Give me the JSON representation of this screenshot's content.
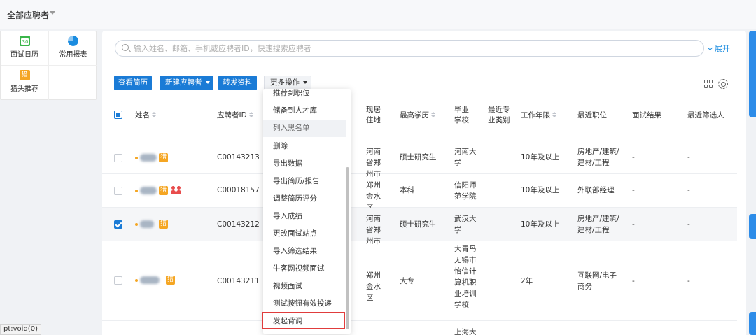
{
  "topbar": {
    "scope_label": "全部应聘者"
  },
  "quick_links": [
    {
      "label": "面试日历",
      "icon": "calendar-icon",
      "color": "#3ab54a"
    },
    {
      "label": "常用报表",
      "icon": "pie-chart-icon",
      "color": "#1a8ce0"
    },
    {
      "label": "猎头推荐",
      "icon": "headhunter-icon",
      "color": "#f5a623"
    }
  ],
  "search": {
    "placeholder": "输入姓名、邮箱、手机或应聘者ID，快速搜索应聘者",
    "value": "",
    "expand_label": "展开"
  },
  "toolbar": {
    "view_resume": "查看简历",
    "new_candidate": "新建应聘者",
    "forward": "转发资料",
    "more_actions": "更多操作"
  },
  "table": {
    "headers": {
      "name": "姓名",
      "id": "应聘者ID",
      "residence": "现居住地",
      "education": "最高学历",
      "school": "毕业学校",
      "major": "最近专业类别",
      "years": "工作年限",
      "position": "最近职位",
      "interview": "面试结果",
      "screener": "最近筛选人"
    },
    "rows": [
      {
        "checked": false,
        "id": "C00143213",
        "residence": "河南省郑州市",
        "education": "硕士研究生",
        "school": "河南大学",
        "major": "",
        "years": "10年及以上",
        "position": "房地产/建筑/建材/工程",
        "interview": "-",
        "screener": "-",
        "tag": "猎",
        "people": false
      },
      {
        "checked": false,
        "id": "C00018157",
        "residence": "郑州金水区",
        "education": "本科",
        "school": "信阳师范学院",
        "major": "",
        "years": "10年及以上",
        "position": "外联部经理",
        "interview": "-",
        "screener": "-",
        "tag": "猎",
        "people": true
      },
      {
        "checked": true,
        "id": "C00143212",
        "residence": "河南省郑州市",
        "education": "硕士研究生",
        "school": "武汉大学",
        "major": "",
        "years": "10年及以上",
        "position": "房地产/建筑/建材/工程",
        "interview": "-",
        "screener": "-",
        "tag": "猎",
        "people": false
      },
      {
        "checked": false,
        "id": "C00143211",
        "residence": "郑州金水区",
        "education": "大专",
        "school": "大青鸟无锡市怡信计算机职业培训学校",
        "major": "",
        "years": "2年",
        "position": "互联网/电子商务",
        "interview": "-",
        "screener": "-",
        "tag": "猎",
        "people": false
      }
    ],
    "partial_row": {
      "school": "上海大"
    }
  },
  "more_menu": {
    "items": [
      "推荐到职位",
      "储备到人才库",
      "列入黑名单",
      "删除",
      "导出数据",
      "导出简历/报告",
      "调整简历评分",
      "导入成绩",
      "更改面试站点",
      "导入筛选结果",
      "牛客网视频面试",
      "视频面试",
      "测试按钮有效投递",
      "发起背调"
    ],
    "hovered": "列入黑名单",
    "highlighted": "发起背调"
  },
  "status_tip": "pt:void(0)"
}
